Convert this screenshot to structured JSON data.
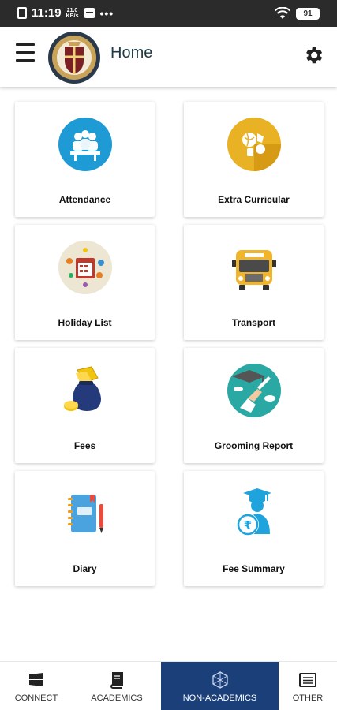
{
  "status_bar": {
    "time": "11:19",
    "speed_value": "21.0",
    "speed_unit": "KB/s",
    "more": "•••",
    "battery": "91"
  },
  "header": {
    "title": "Home",
    "menu_icon": "hamburger-menu-icon",
    "settings_icon": "gear-icon",
    "logo": "school-crest-logo"
  },
  "tiles": [
    {
      "label": "Attendance",
      "icon": "attendance-icon"
    },
    {
      "label": "Extra Curricular",
      "icon": "extra-curricular-icon"
    },
    {
      "label": "Holiday List",
      "icon": "holiday-list-icon"
    },
    {
      "label": "Transport",
      "icon": "school-bus-icon"
    },
    {
      "label": "Fees",
      "icon": "money-bag-icon"
    },
    {
      "label": "Grooming Report",
      "icon": "graduation-icon"
    },
    {
      "label": "Diary",
      "icon": "diary-icon"
    },
    {
      "label": "Fee Summary",
      "icon": "fee-summary-icon"
    }
  ],
  "bottom_nav": [
    {
      "label": "CONNECT",
      "icon": "windows-icon"
    },
    {
      "label": "ACADEMICS",
      "icon": "book-icon"
    },
    {
      "label": "NON-ACADEMICS",
      "icon": "hexagon-icon",
      "active": true
    },
    {
      "label": "OTHER",
      "icon": "list-icon"
    }
  ],
  "colors": {
    "nav_active": "#1b3f78",
    "attendance": "#1e9bd4",
    "extra_curricular": "#e8b224",
    "grooming": "#2aa8a4",
    "fee_summary": "#1ea3dc"
  }
}
